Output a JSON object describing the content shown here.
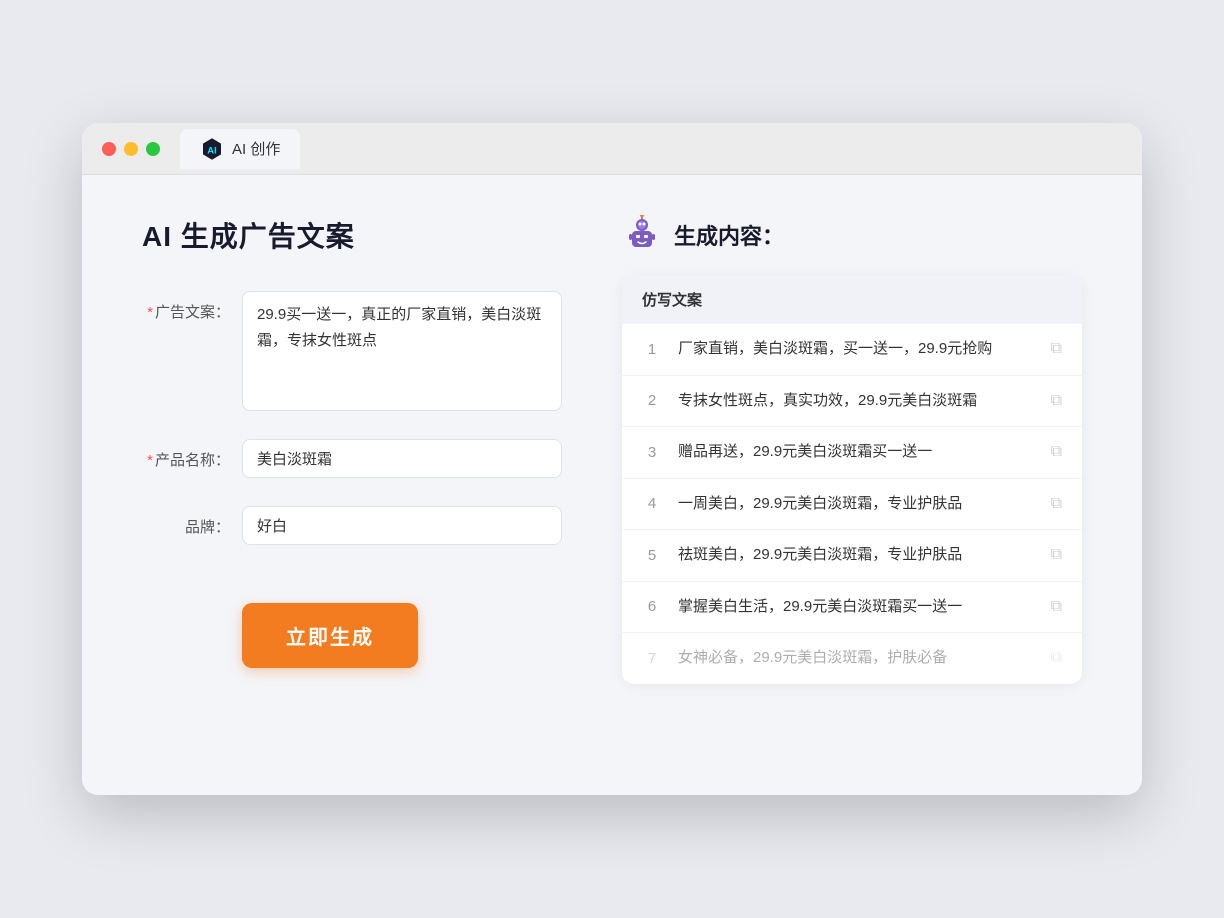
{
  "browser": {
    "tab_label": "AI 创作",
    "traffic_lights": [
      "red",
      "yellow",
      "green"
    ]
  },
  "left_panel": {
    "title": "AI 生成广告文案",
    "form": {
      "ad_copy_label": "广告文案：",
      "ad_copy_required": "*",
      "ad_copy_value": "29.9买一送一，真正的厂家直销，美白淡斑霜，专抹女性斑点",
      "product_name_label": "产品名称：",
      "product_name_required": "*",
      "product_name_value": "美白淡斑霜",
      "brand_label": "品牌：",
      "brand_value": "好白",
      "generate_btn_label": "立即生成"
    }
  },
  "right_panel": {
    "title": "生成内容：",
    "table_header": "仿写文案",
    "results": [
      {
        "num": "1",
        "text": "厂家直销，美白淡斑霜，买一送一，29.9元抢购",
        "faded": false
      },
      {
        "num": "2",
        "text": "专抹女性斑点，真实功效，29.9元美白淡斑霜",
        "faded": false
      },
      {
        "num": "3",
        "text": "赠品再送，29.9元美白淡斑霜买一送一",
        "faded": false
      },
      {
        "num": "4",
        "text": "一周美白，29.9元美白淡斑霜，专业护肤品",
        "faded": false
      },
      {
        "num": "5",
        "text": "祛斑美白，29.9元美白淡斑霜，专业护肤品",
        "faded": false
      },
      {
        "num": "6",
        "text": "掌握美白生活，29.9元美白淡斑霜买一送一",
        "faded": false
      },
      {
        "num": "7",
        "text": "女神必备，29.9元美白淡斑霜，护肤必备",
        "faded": true
      }
    ]
  }
}
